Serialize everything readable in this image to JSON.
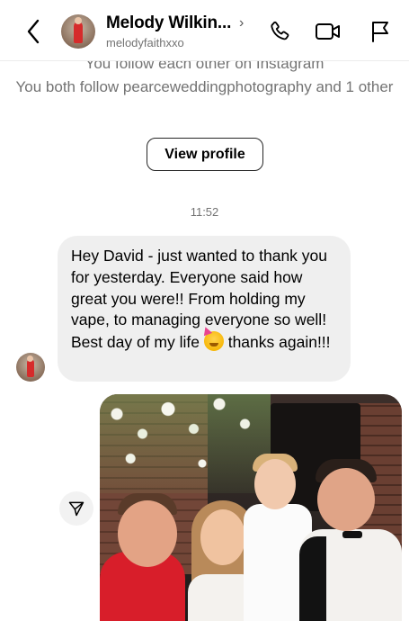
{
  "header": {
    "contact_name": "Melody Wilkin...",
    "chevron": "›",
    "handle": "melodyfaithxxo",
    "icons": [
      "back-arrow-icon",
      "phone-icon",
      "video-camera-icon",
      "flag-icon"
    ]
  },
  "profile_info": {
    "follow_each_other": "You follow each other on Instagram",
    "mutual_follow": "You both follow pearceweddingphotography and 1 other",
    "view_profile_label": "View profile"
  },
  "thread": {
    "timestamp": "11:52",
    "message": {
      "text_before_emoji": "Hey David - just wanted to thank you for yesterday. Everyone said how great you were!! From holding my vape, to managing everyone so well! Best day of my life ",
      "emoji": "partying-face",
      "text_after_emoji": " thanks again!!!"
    }
  },
  "colors": {
    "bubble_bg": "#efefef",
    "secondary_text": "#737373",
    "divider": "#ececec"
  }
}
